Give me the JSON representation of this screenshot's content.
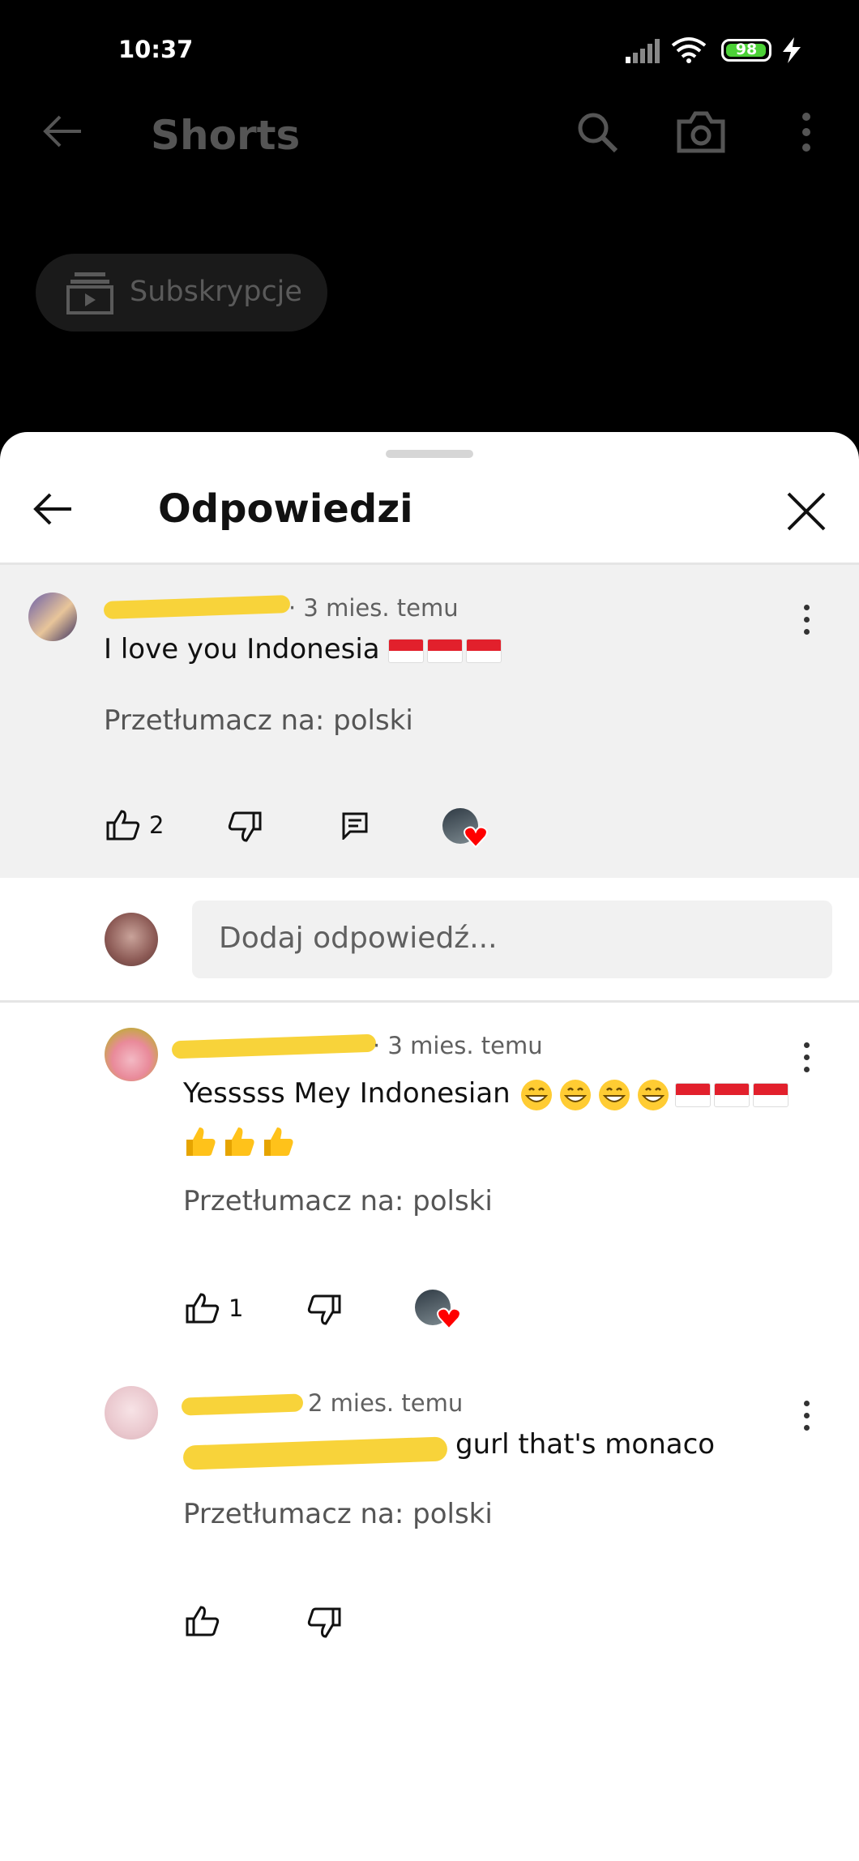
{
  "status_bar": {
    "time": "10:37",
    "battery_level": "98",
    "battery_color": "#4cd137"
  },
  "app_bar": {
    "title": "Shorts",
    "chip_label": "Subskrypcje"
  },
  "sheet": {
    "title": "Odpowiedzi",
    "reply_placeholder": "Dodaj odpowiedź..."
  },
  "comments": [
    {
      "time": "· 3 mies. temu",
      "text": "I love you Indonesia",
      "trailing_icons": [
        "indonesia-flag-icon",
        "indonesia-flag-icon",
        "indonesia-flag-icon"
      ],
      "translate": "Przetłumacz na: polski",
      "likes": "2"
    },
    {
      "time": "· 3 mies. temu",
      "text": "Yesssss Mey Indonesian",
      "trailing_icons": [
        "grin-emoji-icon",
        "grin-emoji-icon",
        "grin-emoji-icon",
        "grin-emoji-icon",
        "indonesia-flag-icon",
        "indonesia-flag-icon",
        "indonesia-flag-icon",
        "thumbs-up-emoji-icon",
        "thumbs-up-emoji-icon",
        "thumbs-up-emoji-icon"
      ],
      "translate": "Przetłumacz na: polski",
      "likes": "1"
    },
    {
      "time": "2 mies. temu",
      "text": "gurl that's monaco",
      "translate": "Przetłumacz na: polski",
      "likes": ""
    }
  ],
  "colors": {
    "highlight": "#f1f1f1",
    "redaction": "#f8d33a",
    "heart": "#ff0000"
  }
}
